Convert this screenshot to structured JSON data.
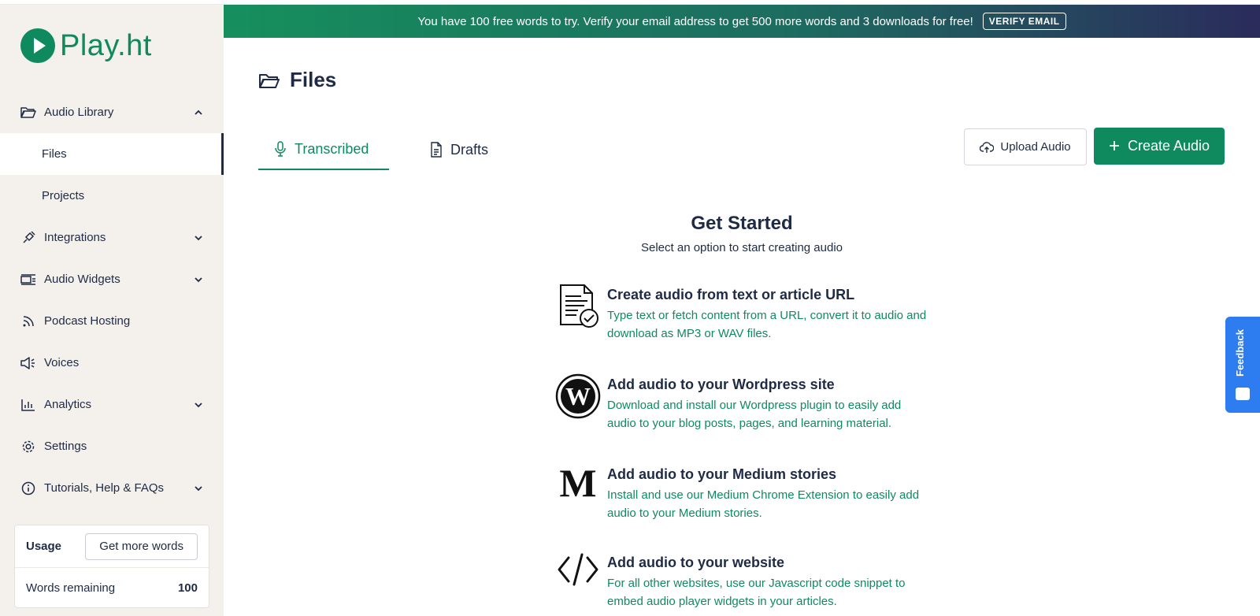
{
  "brand": {
    "name": "Play.ht",
    "color": "#0f8a5f"
  },
  "banner": {
    "message": "You have 100 free words to try. Verify your email address to get 500 more words and 3 downloads for free!",
    "verify_label": "VERIFY EMAIL"
  },
  "sidebar": {
    "items": [
      {
        "label": "Audio Library",
        "icon": "folder-open-icon",
        "chevron": "up"
      },
      {
        "label": "Files",
        "sub": true,
        "active": true
      },
      {
        "label": "Projects",
        "sub": true
      },
      {
        "label": "Integrations",
        "icon": "plug-icon",
        "chevron": "down"
      },
      {
        "label": "Audio Widgets",
        "icon": "widget-icon",
        "chevron": "down"
      },
      {
        "label": "Podcast Hosting",
        "icon": "rss-icon"
      },
      {
        "label": "Voices",
        "icon": "speaker-icon"
      },
      {
        "label": "Analytics",
        "icon": "bar-chart-icon",
        "chevron": "down"
      },
      {
        "label": "Settings",
        "icon": "gear-icon"
      },
      {
        "label": "Tutorials, Help & FAQs",
        "icon": "info-icon",
        "chevron": "down"
      }
    ],
    "usage": {
      "label": "Usage",
      "more_words_label": "Get more words",
      "words_remaining_label": "Words remaining",
      "words_remaining": "100"
    }
  },
  "main": {
    "title": "Files",
    "tabs": [
      {
        "label": "Transcribed",
        "icon": "microphone-icon",
        "active": true
      },
      {
        "label": "Drafts",
        "icon": "document-icon"
      }
    ],
    "upload_label": "Upload Audio",
    "create_label": "Create Audio",
    "get_started": {
      "title": "Get Started",
      "subtitle": "Select an option to start creating audio",
      "options": [
        {
          "title": "Create audio from text or article URL",
          "desc": "Type text or fetch content from a URL, convert it to audio and download as MP3 or WAV files.",
          "icon": "article-check-icon"
        },
        {
          "title": "Add audio to your Wordpress site",
          "desc": "Download and install our Wordpress plugin to easily add audio to your blog posts, pages, and learning material.",
          "icon": "wordpress-icon"
        },
        {
          "title": "Add audio to your Medium stories",
          "desc": "Install and use our Medium Chrome Extension to easily add audio to your Medium stories.",
          "icon": "medium-icon"
        },
        {
          "title": "Add audio to your website",
          "desc": "For all other websites, use our Javascript code snippet to embed audio player widgets in your articles.",
          "icon": "code-icon"
        }
      ]
    }
  },
  "feedback": {
    "label": "Feedback",
    "color": "#2d7cf0"
  }
}
